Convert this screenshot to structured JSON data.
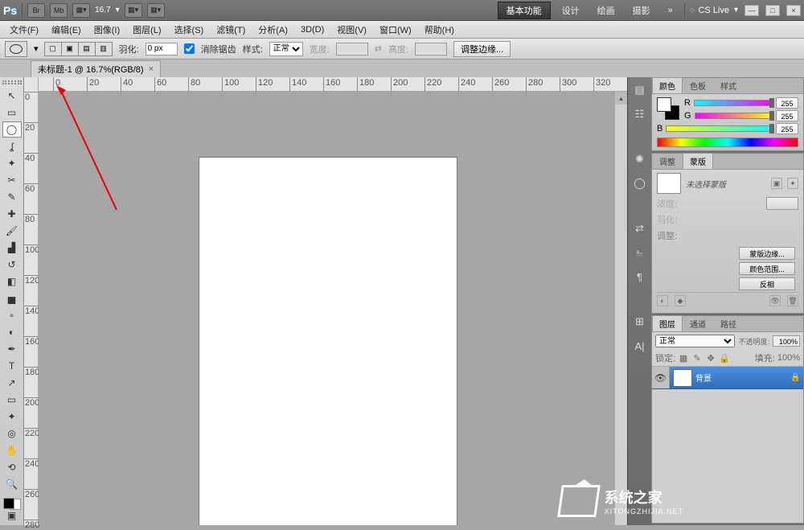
{
  "app": {
    "name": "Ps",
    "zoom_label": "16.7",
    "workspace_active": "基本功能",
    "workspaces": [
      "设计",
      "绘画",
      "摄影"
    ],
    "more": "»",
    "cslive": "CS Live",
    "winbuttons": [
      "—",
      "□",
      "×"
    ],
    "topicons": [
      "Br",
      "Mb",
      "▦▾",
      "▦▾",
      "▦▾"
    ]
  },
  "menu": [
    "文件(F)",
    "编辑(E)",
    "图像(I)",
    "图层(L)",
    "选择(S)",
    "滤镜(T)",
    "分析(A)",
    "3D(D)",
    "视图(V)",
    "窗口(W)",
    "帮助(H)"
  ],
  "options": {
    "feather_label": "羽化:",
    "feather_value": "0 px",
    "antialias_label": "消除锯齿",
    "antialias_checked": true,
    "style_label": "样式:",
    "style_value": "正常",
    "width_label": "宽度:",
    "height_label": "高度:",
    "refine_btn": "调整边缘..."
  },
  "document": {
    "tab_title": "未标题-1 @ 16.7%(RGB/8)"
  },
  "ruler": {
    "hticks": [
      0,
      20,
      40,
      60,
      80,
      100,
      120,
      140,
      160,
      180,
      200,
      220,
      240,
      260,
      280,
      300,
      320
    ],
    "vticks": [
      0,
      20,
      40,
      60,
      80,
      100,
      120,
      140,
      160,
      180,
      200,
      220,
      240,
      260,
      280
    ]
  },
  "tools": [
    {
      "name": "move-tool",
      "glyph": "↖"
    },
    {
      "name": "marquee-tool",
      "glyph": "▭"
    },
    {
      "name": "ellipse-marquee-tool",
      "glyph": "◯",
      "active": true
    },
    {
      "name": "lasso-tool",
      "glyph": "ʆ"
    },
    {
      "name": "quick-select-tool",
      "glyph": "✦"
    },
    {
      "name": "crop-tool",
      "glyph": "✂"
    },
    {
      "name": "eyedropper-tool",
      "glyph": "✎"
    },
    {
      "name": "spot-heal-tool",
      "glyph": "✚"
    },
    {
      "name": "brush-tool",
      "glyph": "🖌"
    },
    {
      "name": "stamp-tool",
      "glyph": "▟"
    },
    {
      "name": "history-brush-tool",
      "glyph": "↺"
    },
    {
      "name": "eraser-tool",
      "glyph": "◧"
    },
    {
      "name": "gradient-tool",
      "glyph": "▅"
    },
    {
      "name": "blur-tool",
      "glyph": "∘"
    },
    {
      "name": "dodge-tool",
      "glyph": "◐"
    },
    {
      "name": "pen-tool",
      "glyph": "✒"
    },
    {
      "name": "type-tool",
      "glyph": "T"
    },
    {
      "name": "path-select-tool",
      "glyph": "↗"
    },
    {
      "name": "shape-tool",
      "glyph": "▭"
    },
    {
      "name": "3d-tool",
      "glyph": "✦"
    },
    {
      "name": "3d-camera-tool",
      "glyph": "◎"
    },
    {
      "name": "hand-tool",
      "glyph": "✋"
    },
    {
      "name": "rotate-view-tool",
      "glyph": "⟲"
    },
    {
      "name": "zoom-tool",
      "glyph": "🔍"
    }
  ],
  "iconstrip": [
    "▤",
    "☷",
    "",
    "✺",
    "◯",
    "",
    "⇄",
    "⎁",
    "¶",
    "",
    "⊞",
    "A|"
  ],
  "color_panel": {
    "tabs": [
      "颜色",
      "色板",
      "样式"
    ],
    "channels": [
      {
        "label": "R",
        "value": "255"
      },
      {
        "label": "G",
        "value": "255"
      },
      {
        "label": "B",
        "value": "255"
      }
    ]
  },
  "mask_panel": {
    "tabs": [
      "调整",
      "蒙版"
    ],
    "placeholder": "未选择蒙版",
    "density_label": "浓度:",
    "feather_label": "羽化:",
    "adjust_label": "调整:",
    "buttons": [
      "蒙版边缘...",
      "颜色范围...",
      "反相"
    ]
  },
  "layers_panel": {
    "tabs": [
      "图层",
      "通道",
      "路径"
    ],
    "blend_mode": "正常",
    "opacity_label": "不透明度:",
    "opacity_value": "100%",
    "lock_label": "锁定:",
    "fill_label": "填充:",
    "fill_value": "100%",
    "layer_name": "背景"
  },
  "watermark": {
    "title": "系统之家",
    "sub": "XITONGZHIJIA.NET"
  }
}
